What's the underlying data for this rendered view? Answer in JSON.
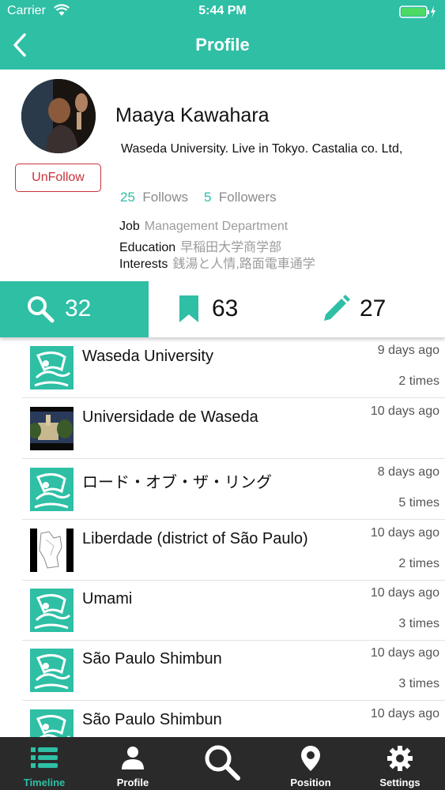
{
  "status_bar": {
    "carrier": "Carrier",
    "time": "5:44 PM"
  },
  "nav": {
    "title": "Profile",
    "back_icon": "chevron-left-icon"
  },
  "profile": {
    "name": "Maaya Kawahara",
    "bio": "Waseda University. Live in Tokyo. Castalia co. Ltd,",
    "follow_button": "UnFollow",
    "follows_count": "25",
    "follows_label": "Follows",
    "followers_count": "5",
    "followers_label": "Followers",
    "job_label": "Job",
    "job_value": "Management Department",
    "education_label": "Education",
    "education_value": "早稲田大学商学部",
    "interests_label": "Interests",
    "interests_value": "銭湯と人情,路面電車通学"
  },
  "tabs": [
    {
      "icon": "search-icon",
      "count": "32",
      "active": true
    },
    {
      "icon": "bookmark-icon",
      "count": "63",
      "active": false
    },
    {
      "icon": "pencil-icon",
      "count": "27",
      "active": false
    }
  ],
  "list": [
    {
      "title": "Waseda University",
      "ago": "9 days ago",
      "times": "2 times",
      "thumb": "placeholder-icon"
    },
    {
      "title": "Universidade de Waseda",
      "ago": "10 days ago",
      "times": "",
      "thumb": "photo"
    },
    {
      "title": "ロード・オブ・ザ・リング",
      "ago": "8 days ago",
      "times": "5 times",
      "thumb": "placeholder-icon"
    },
    {
      "title": "Liberdade (district of São Paulo)",
      "ago": "10 days ago",
      "times": "2 times",
      "thumb": "map"
    },
    {
      "title": "Umami",
      "ago": "10 days ago",
      "times": "3 times",
      "thumb": "placeholder-icon"
    },
    {
      "title": "São Paulo Shimbun",
      "ago": "10 days ago",
      "times": "3 times",
      "thumb": "placeholder-icon"
    },
    {
      "title": "São Paulo Shimbun",
      "ago": "10 days ago",
      "times": "",
      "thumb": "placeholder-icon"
    }
  ],
  "tabbar": [
    {
      "label": "Timeline",
      "icon": "list-icon",
      "active": true
    },
    {
      "label": "Profile",
      "icon": "person-icon",
      "active": false
    },
    {
      "label": "",
      "icon": "search-icon",
      "active": false
    },
    {
      "label": "Position",
      "icon": "location-pin-icon",
      "active": false
    },
    {
      "label": "Settings",
      "icon": "gear-icon",
      "active": false
    }
  ],
  "colors": {
    "accent": "#2ebfa5",
    "danger": "#c9323e",
    "tabbar": "#2a2a2a"
  }
}
